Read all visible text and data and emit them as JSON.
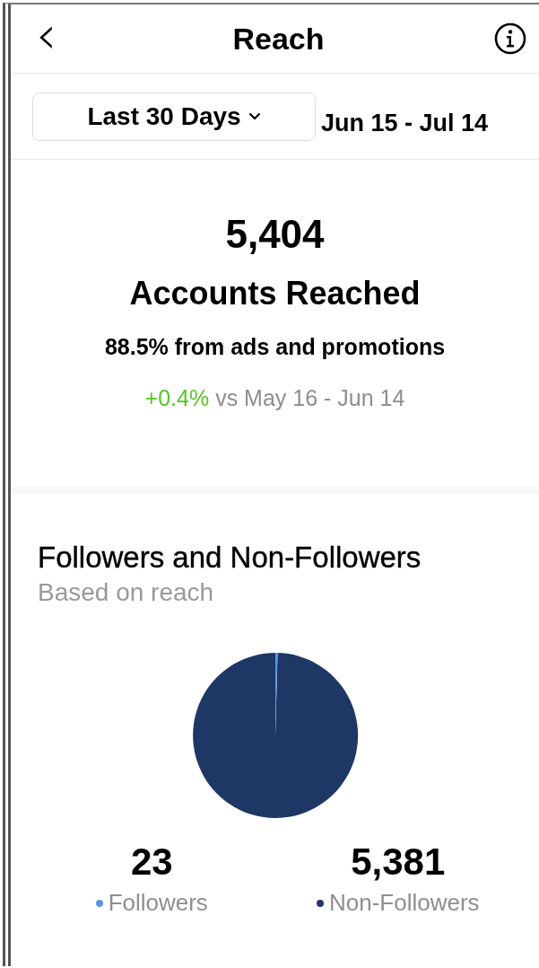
{
  "header": {
    "back": "‹",
    "title": "Reach"
  },
  "filter": {
    "period": "Last 30 Days",
    "range": "Jun 15 - Jul 14"
  },
  "summary": {
    "total": "5,404",
    "label": "Accounts Reached",
    "source": "88.5% from ads and promotions",
    "change": "+0.4%",
    "comparison": "vs May 16 - Jun 14"
  },
  "audience": {
    "title": "Followers and Non-Followers",
    "subtitle": "Based on reach",
    "chart_data": {
      "type": "pie",
      "categories": [
        "Followers",
        "Non-Followers"
      ],
      "values": [
        0.43,
        99.57
      ],
      "colors": [
        "#5b95e6",
        "#1e3765"
      ]
    },
    "stats": [
      {
        "value": "23"
      },
      {
        "value": "5,381"
      }
    ]
  }
}
